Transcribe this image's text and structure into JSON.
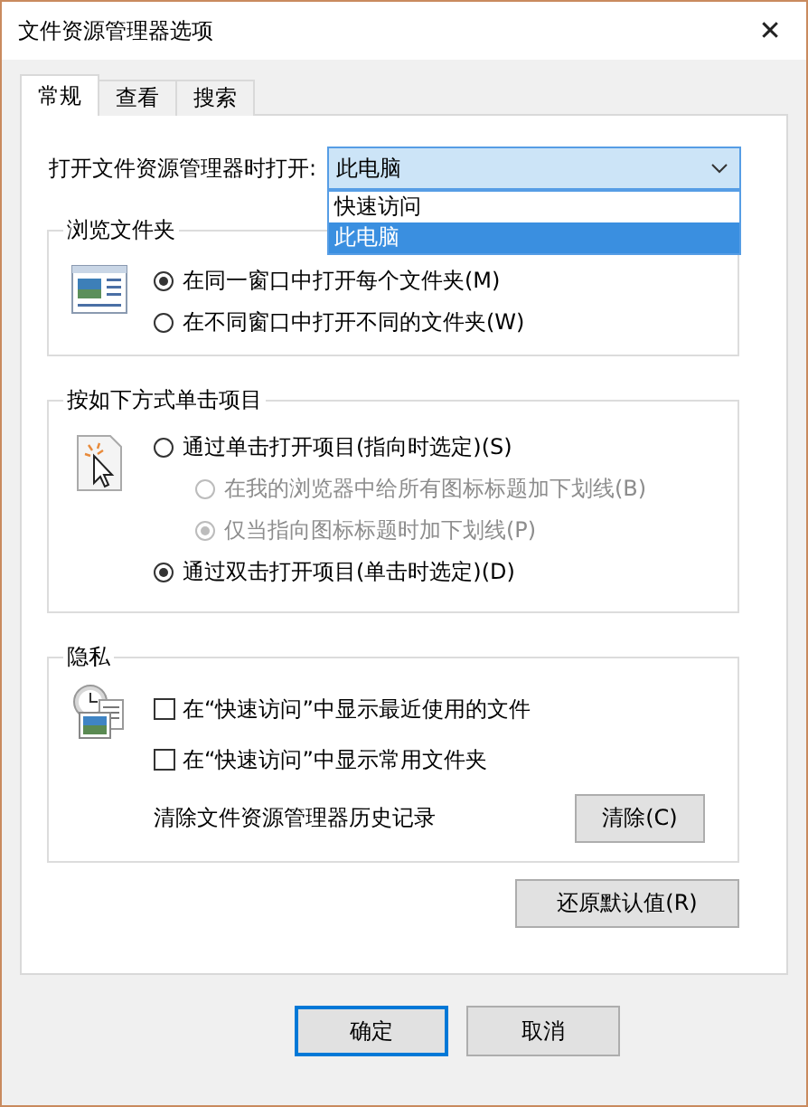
{
  "window": {
    "title": "文件资源管理器选项",
    "close": "✕"
  },
  "tabs": [
    {
      "label": "常规",
      "selected": true
    },
    {
      "label": "查看",
      "selected": false
    },
    {
      "label": "搜索",
      "selected": false
    }
  ],
  "open_with": {
    "label": "打开文件资源管理器时打开:",
    "value": "此电脑",
    "expanded": true,
    "options": [
      {
        "label": "快速访问",
        "selected": false
      },
      {
        "label": "此电脑",
        "selected": true
      }
    ]
  },
  "groups": [
    {
      "title": "浏览文件夹",
      "items": [
        {
          "kind": "radio",
          "label": "在同一窗口中打开每个文件夹(M)",
          "selected": true,
          "disabled": false
        },
        {
          "kind": "radio",
          "label": "在不同窗口中打开不同的文件夹(W)",
          "selected": false,
          "disabled": false
        }
      ]
    },
    {
      "title": "按如下方式单击项目",
      "items": [
        {
          "kind": "radio",
          "label": "通过单击打开项目(指向时选定)(S)",
          "selected": false,
          "disabled": false,
          "children": [
            {
              "kind": "radio",
              "label": "在我的浏览器中给所有图标标题加下划线(B)",
              "selected": false,
              "disabled": true
            },
            {
              "kind": "radio",
              "label": "仅当指向图标标题时加下划线(P)",
              "selected": true,
              "disabled": true
            }
          ]
        },
        {
          "kind": "radio",
          "label": "通过双击打开项目(单击时选定)(D)",
          "selected": true,
          "disabled": false
        }
      ]
    },
    {
      "title": "隐私",
      "items": [
        {
          "kind": "checkbox",
          "label": "在“快速访问”中显示最近使用的文件",
          "checked": false
        },
        {
          "kind": "checkbox",
          "label": "在“快速访问”中显示常用文件夹",
          "checked": false
        },
        {
          "kind": "action",
          "label": "清除文件资源管理器历史记录",
          "button": "清除(C)"
        }
      ]
    }
  ],
  "restore_button": "还原默认值(R)",
  "buttons": [
    {
      "label": "确定",
      "default": true
    },
    {
      "label": "取消",
      "default": false
    }
  ]
}
